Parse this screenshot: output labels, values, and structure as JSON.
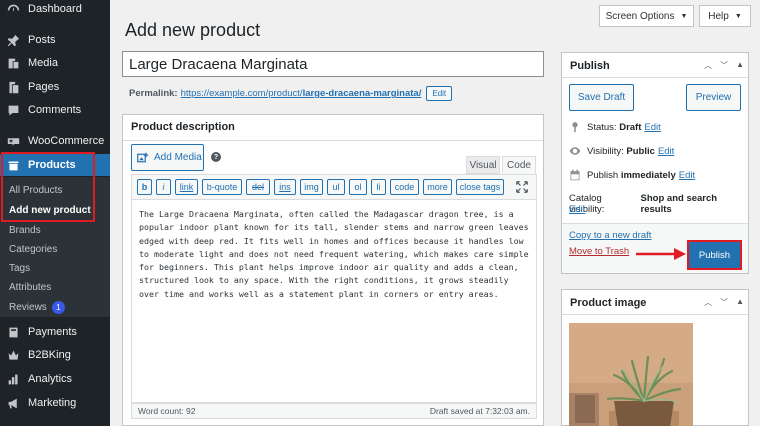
{
  "sidebar": {
    "items": [
      {
        "label": "Dashboard",
        "icon": "dashboard-icon"
      },
      {
        "label": "Posts",
        "icon": "pushpin-icon"
      },
      {
        "label": "Media",
        "icon": "media-icon"
      },
      {
        "label": "Pages",
        "icon": "pages-icon"
      },
      {
        "label": "Comments",
        "icon": "comments-icon"
      },
      {
        "label": "WooCommerce",
        "icon": "woocommerce-icon"
      },
      {
        "label": "Products",
        "icon": "products-icon"
      },
      {
        "label": "Payments",
        "icon": "payments-icon"
      },
      {
        "label": "B2BKing",
        "icon": "b2bking-icon"
      },
      {
        "label": "Analytics",
        "icon": "analytics-icon"
      },
      {
        "label": "Marketing",
        "icon": "marketing-icon"
      }
    ],
    "products_submenu": [
      "All Products",
      "Add new product",
      "Brands",
      "Categories",
      "Tags",
      "Attributes",
      "Reviews"
    ],
    "reviews_badge": "1",
    "accent_color": "#2271b1"
  },
  "header": {
    "screen_options": "Screen Options",
    "help": "Help",
    "title": "Add new product"
  },
  "product": {
    "title": "Large Dracaena Marginata",
    "permalink_label": "Permalink:",
    "permalink_base": "https://example.com/product/",
    "permalink_slug": "large-dracaena-marginata/",
    "permalink_edit": "Edit"
  },
  "description": {
    "heading": "Product description",
    "add_media": "Add Media",
    "tab_visual": "Visual",
    "tab_code": "Code",
    "toolbar": [
      "b",
      "i",
      "link",
      "b-quote",
      "del",
      "ins",
      "img",
      "ul",
      "ol",
      "li",
      "code",
      "more",
      "close tags"
    ],
    "content": "The Large Dracaena Marginata, often called the Madagascar dragon tree, is a popular indoor plant known for its tall, slender stems and narrow green leaves edged with deep red. It fits well in homes and offices because it handles low to moderate light and does not need frequent watering, which makes care simple for beginners. This plant helps improve indoor air quality and adds a clean, structured look to any space. With the right conditions, it grows steadily over time and works well as a statement plant in corners or entry areas.",
    "word_count": "Word count: 92",
    "draft_saved": "Draft saved at 7:32:03 am."
  },
  "publish": {
    "heading": "Publish",
    "save_draft": "Save Draft",
    "preview": "Preview",
    "status_label": "Status:",
    "status_value": "Draft",
    "visibility_label": "Visibility:",
    "visibility_value": "Public",
    "publish_label": "Publish",
    "publish_value": "immediately",
    "catalog_label": "Catalog visibility:",
    "catalog_value": "Shop and search results",
    "edit": "Edit",
    "copy_draft": "Copy to a new draft",
    "move_trash": "Move to Trash",
    "publish_button": "Publish"
  },
  "product_image": {
    "heading": "Product image"
  }
}
